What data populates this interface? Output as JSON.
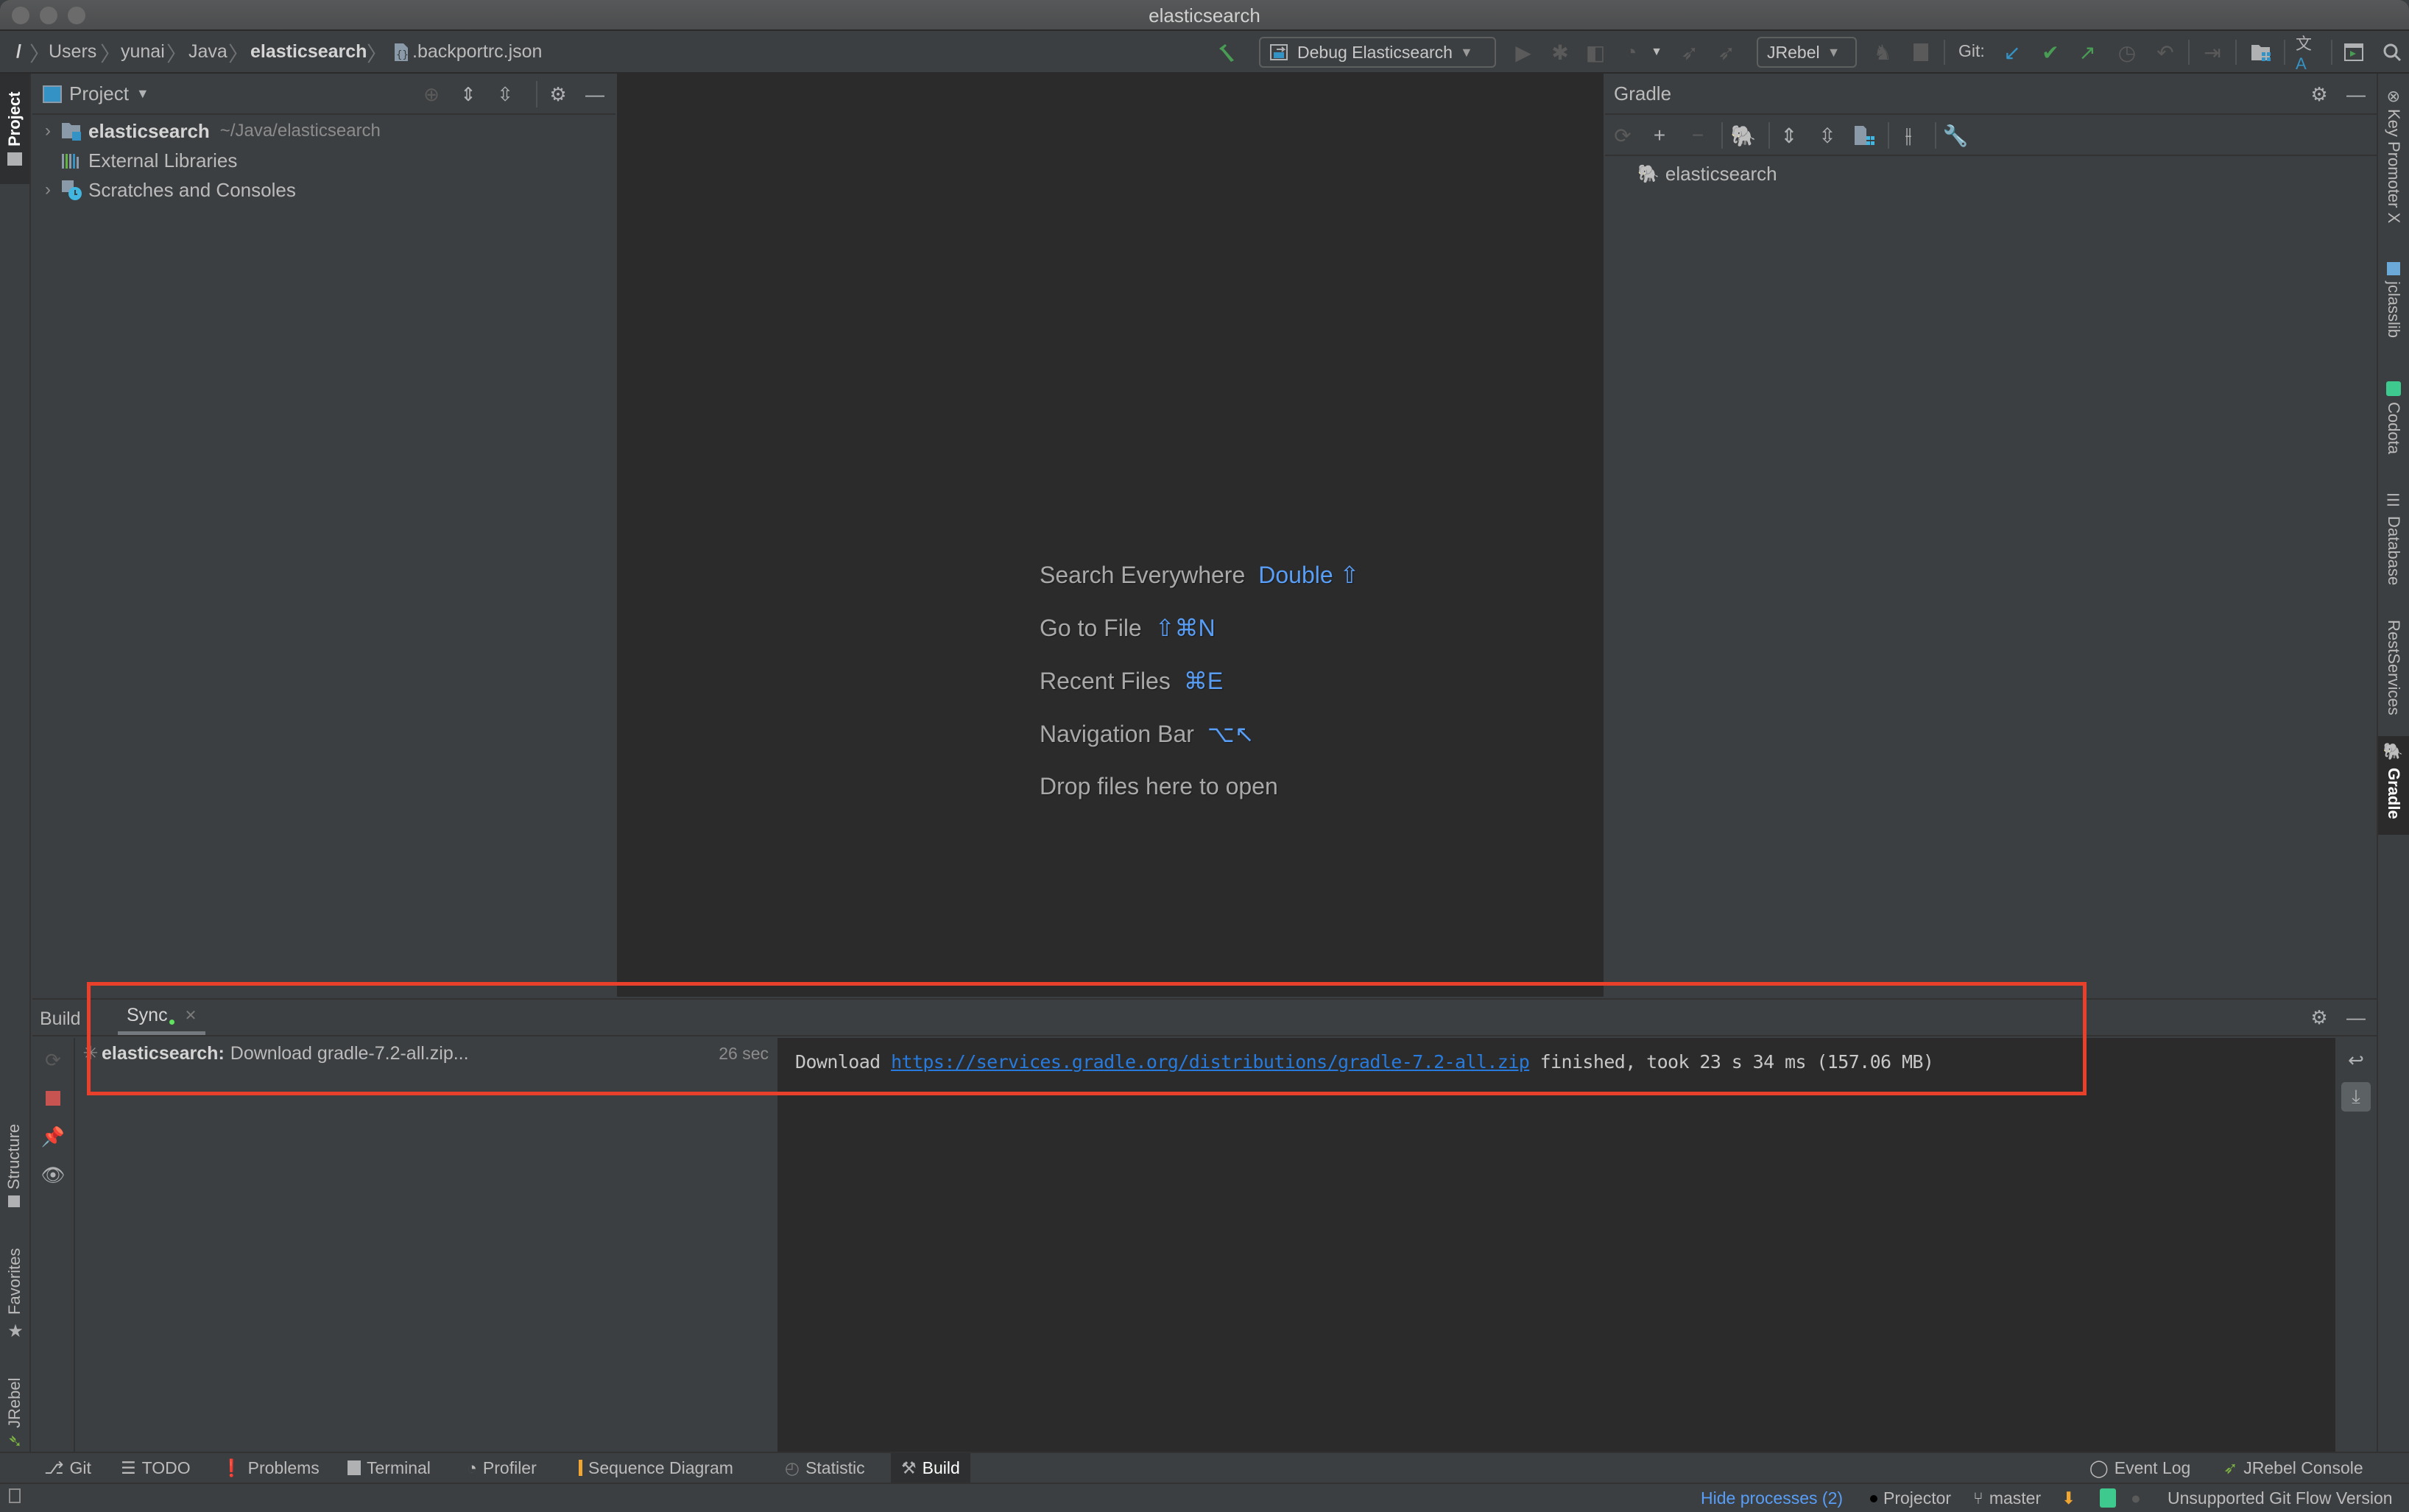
{
  "window": {
    "title": "elasticsearch"
  },
  "breadcrumbs": [
    {
      "label": "/"
    },
    {
      "label": "Users"
    },
    {
      "label": "yunai"
    },
    {
      "label": "Java"
    },
    {
      "label": "elasticsearch"
    },
    {
      "label": ".backportrc.json"
    }
  ],
  "toolbar": {
    "run_config": "Debug Elasticsearch",
    "jrebel_config": "JRebel",
    "git_label": "Git:"
  },
  "left_stripe": {
    "top": [
      {
        "label": "Project"
      }
    ],
    "bottom": [
      {
        "label": "Structure"
      },
      {
        "label": "Favorites"
      },
      {
        "label": "JRebel"
      }
    ]
  },
  "right_stripe": [
    {
      "label": "Key Promoter X"
    },
    {
      "label": "jclasslib"
    },
    {
      "label": "Codota"
    },
    {
      "label": "Database"
    },
    {
      "label": "RestServices"
    },
    {
      "label": "Gradle"
    }
  ],
  "project_panel": {
    "title": "Project",
    "tree": [
      {
        "name": "elasticsearch",
        "path": "~/Java/elasticsearch",
        "expandable": true
      },
      {
        "name": "External Libraries",
        "expandable": false
      },
      {
        "name": "Scratches and Consoles",
        "expandable": true
      }
    ]
  },
  "editor": {
    "hints": [
      {
        "label": "Search Everywhere",
        "shortcut": "Double ⇧"
      },
      {
        "label": "Go to File",
        "shortcut": "⇧⌘N"
      },
      {
        "label": "Recent Files",
        "shortcut": "⌘E"
      },
      {
        "label": "Navigation Bar",
        "shortcut": "⌥↖"
      },
      {
        "label": "Drop files here to open",
        "shortcut": ""
      }
    ]
  },
  "gradle_panel": {
    "title": "Gradle",
    "tree": [
      {
        "name": "elasticsearch"
      }
    ]
  },
  "build_panel": {
    "label": "Build",
    "tabs": [
      {
        "label": "Sync",
        "closable": true,
        "active": true
      }
    ],
    "tree": [
      {
        "project": "elasticsearch:",
        "task": "Download gradle-7.2-all.zip...",
        "duration": "26 sec"
      }
    ],
    "console": {
      "prefix": "Download",
      "link": "https://services.gradle.org/distributions/gradle-7.2-all.zip",
      "suffix": "finished, took 23 s 34 ms (157.06 MB)"
    }
  },
  "tool_tabs": [
    {
      "label": "Git",
      "icon": "git-icon"
    },
    {
      "label": "TODO",
      "icon": "todo-icon"
    },
    {
      "label": "Problems",
      "icon": "problems-icon"
    },
    {
      "label": "Terminal",
      "icon": "terminal-icon"
    },
    {
      "label": "Profiler",
      "icon": "profiler-icon"
    },
    {
      "label": "Sequence Diagram",
      "icon": "sequence-diagram-icon"
    },
    {
      "label": "Statistic",
      "icon": "statistic-icon"
    },
    {
      "label": "Build",
      "icon": "build-icon",
      "active": true
    }
  ],
  "tool_tabs_right": [
    {
      "label": "Event Log"
    },
    {
      "label": "JRebel Console"
    }
  ],
  "status_bar": {
    "hide_processes": "Hide processes (2)",
    "projector": "Projector",
    "branch": "master",
    "git_flow": "Unsupported Git Flow Version"
  },
  "colors": {
    "accent_link": "#589df6",
    "highlight_box": "#e8402b",
    "green": "#499c54"
  }
}
